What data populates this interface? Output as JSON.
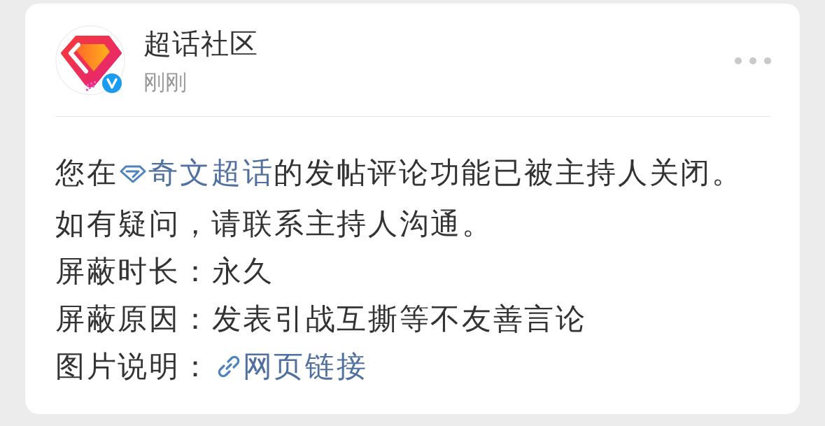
{
  "post": {
    "author": {
      "name": "超话社区",
      "verified": true
    },
    "time": "刚刚",
    "message": {
      "before": "您在",
      "link": "奇文超话",
      "after": "的发帖评论功能已被主持人关闭。"
    },
    "note": "如有疑问，请联系主持人沟通。",
    "details": [
      {
        "kind": "text",
        "label": "屏蔽时长：",
        "value": "永久"
      },
      {
        "kind": "text",
        "label": "屏蔽原因：",
        "value": "发表引战互撕等不友善言论"
      },
      {
        "kind": "link",
        "label": "图片说明：",
        "value": "网页链接"
      }
    ]
  }
}
